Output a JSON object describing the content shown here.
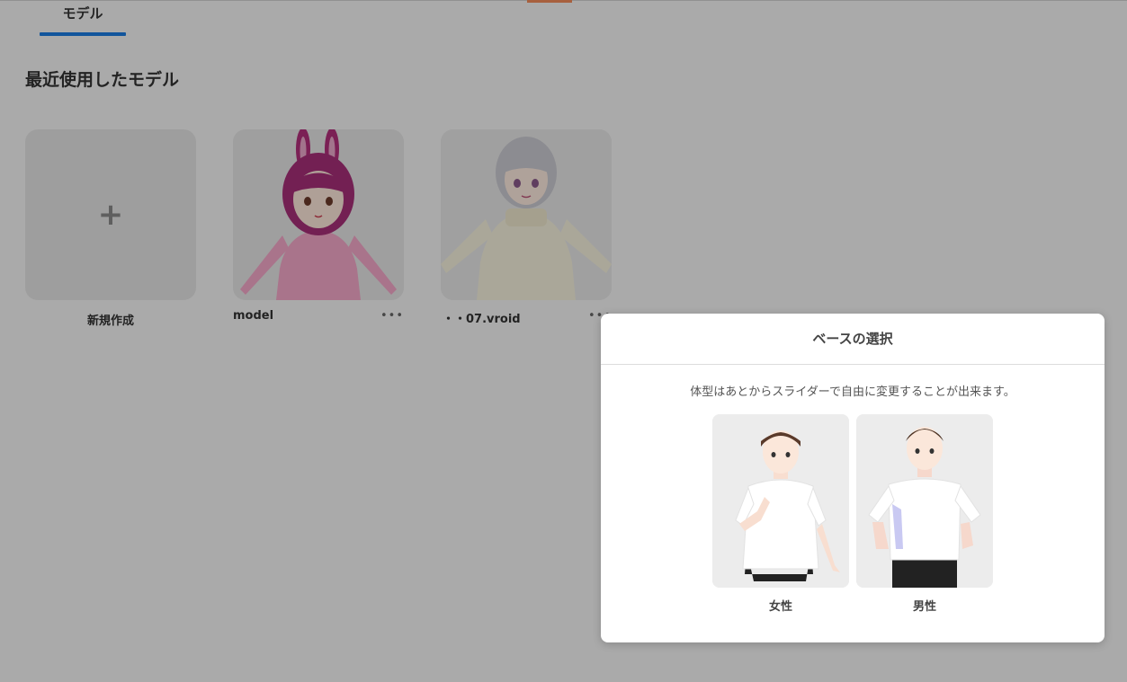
{
  "header": {
    "tab_label": "モデル"
  },
  "section": {
    "title": "最近使用したモデル"
  },
  "models": [
    {
      "name": "新規作成",
      "icon": "plus-icon"
    },
    {
      "name": "model",
      "more_icon": "•••"
    },
    {
      "name": "・・07.vroid",
      "more_icon": "•••"
    }
  ],
  "dialog": {
    "title": "ベースの選択",
    "description": "体型はあとからスライダーで自由に変更することが出来ます。",
    "options": [
      {
        "label": "女性"
      },
      {
        "label": "男性"
      }
    ]
  },
  "colors": {
    "accent": "#1a7ae0",
    "overlay": "rgba(0,0,0,0.30)"
  }
}
